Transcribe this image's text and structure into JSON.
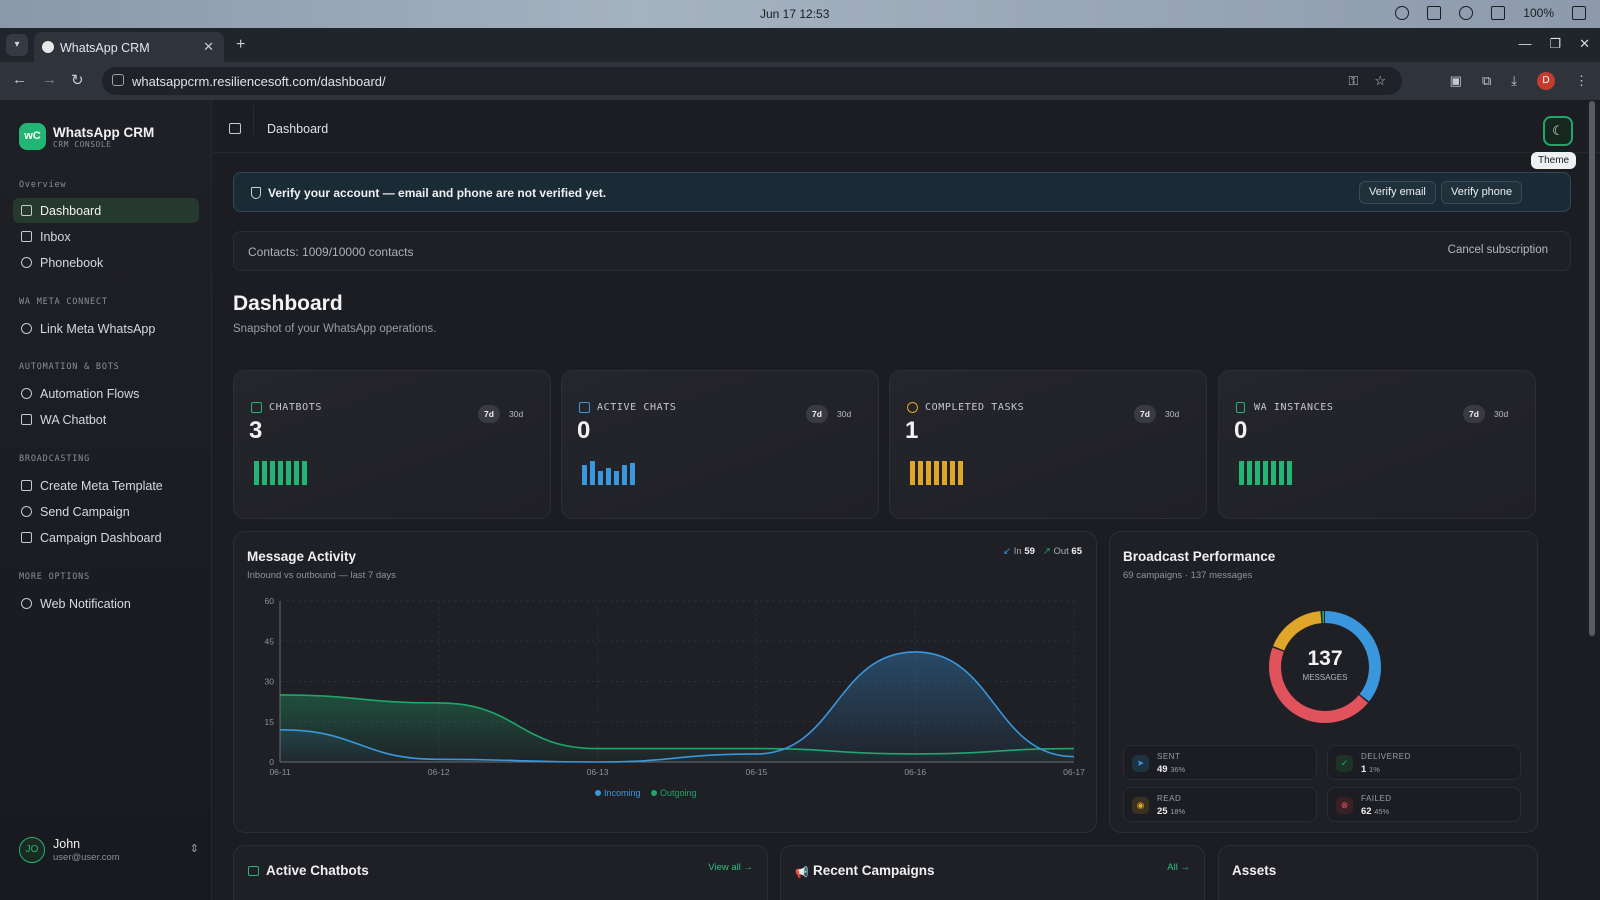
{
  "os": {
    "clock": "Jun 17  12:53",
    "battery": "100%"
  },
  "browser": {
    "tab_title": "WhatsApp CRM",
    "url": "whatsappcrm.resiliencesoft.com/dashboard/",
    "profile_initial": "D"
  },
  "sidebar": {
    "brand_logo": "wC",
    "brand_name": "WhatsApp CRM",
    "brand_sub": "CRM CONSOLE",
    "sections": {
      "overview": "Overview",
      "meta": "WA META CONNECT",
      "automation": "AUTOMATION & BOTS",
      "broadcasting": "BROADCASTING",
      "more": "MORE OPTIONS"
    },
    "items": {
      "dashboard": "Dashboard",
      "inbox": "Inbox",
      "phonebook": "Phonebook",
      "link_meta": "Link Meta WhatsApp",
      "automation_flows": "Automation Flows",
      "wa_chatbot": "WA Chatbot",
      "create_template": "Create Meta Template",
      "send_campaign": "Send Campaign",
      "campaign_dashboard": "Campaign Dashboard",
      "web_notification": "Web Notification"
    },
    "user": {
      "initials": "JO",
      "name": "John",
      "email": "user@user.com"
    }
  },
  "topbar": {
    "breadcrumb": "Dashboard",
    "theme_tooltip": "Theme"
  },
  "verify": {
    "message": "Verify your account — email and phone are not verified yet.",
    "email_btn": "Verify email",
    "phone_btn": "Verify phone"
  },
  "contacts": {
    "text": "Contacts: 1009/10000 contacts",
    "cancel": "Cancel subscription"
  },
  "page": {
    "title": "Dashboard",
    "subtitle": "Snapshot of your WhatsApp operations."
  },
  "stats": [
    {
      "label": "CHATBOTS",
      "value": "3",
      "range_a": "7d",
      "range_b": "30d",
      "color": "#22b573"
    },
    {
      "label": "ACTIVE CHATS",
      "value": "0",
      "range_a": "7d",
      "range_b": "30d",
      "color": "#3a97dd"
    },
    {
      "label": "COMPLETED TASKS",
      "value": "1",
      "range_a": "7d",
      "range_b": "30d",
      "color": "#e0a62a"
    },
    {
      "label": "WA INSTANCES",
      "value": "0",
      "range_a": "7d",
      "range_b": "30d",
      "color": "#22b573"
    }
  ],
  "message_activity": {
    "title": "Message Activity",
    "subtitle": "Inbound vs outbound — last 7 days",
    "in_label": "In",
    "in_value": "59",
    "out_label": "Out",
    "out_value": "65"
  },
  "chart_data": {
    "type": "area",
    "x": [
      "06-11",
      "06-12",
      "06-13",
      "06-15",
      "06-16",
      "06-17"
    ],
    "ylim": [
      0,
      60
    ],
    "yticks": [
      "60",
      "45",
      "30",
      "15",
      "0"
    ],
    "series": [
      {
        "name": "Incoming",
        "color": "#3a97dd",
        "values": [
          12,
          1,
          0,
          3,
          41,
          2
        ]
      },
      {
        "name": "Outgoing",
        "color": "#1fa66a",
        "values": [
          25,
          22,
          5,
          5,
          3,
          5
        ]
      }
    ],
    "grid": true,
    "legend": "bottom"
  },
  "broadcast": {
    "title": "Broadcast Performance",
    "subtitle": "69 campaigns · 137 messages",
    "total": "137",
    "total_label": "MESSAGES",
    "segments": [
      {
        "name": "SENT",
        "value": "49",
        "pct": "36%",
        "color": "#3a97dd",
        "frac": 0.36
      },
      {
        "name": "DELIVERED",
        "value": "1",
        "pct": "1%",
        "color": "#1fa66a",
        "frac": 0.01
      },
      {
        "name": "READ",
        "value": "25",
        "pct": "18%",
        "color": "#e0a62a",
        "frac": 0.18
      },
      {
        "name": "FAILED",
        "value": "62",
        "pct": "45%",
        "color": "#e0525c",
        "frac": 0.45
      }
    ]
  },
  "bottom": {
    "chatbots_title": "Active Chatbots",
    "chatbots_link": "View all →",
    "campaigns_title": "Recent Campaigns",
    "campaigns_link": "All →",
    "assets_title": "Assets"
  }
}
